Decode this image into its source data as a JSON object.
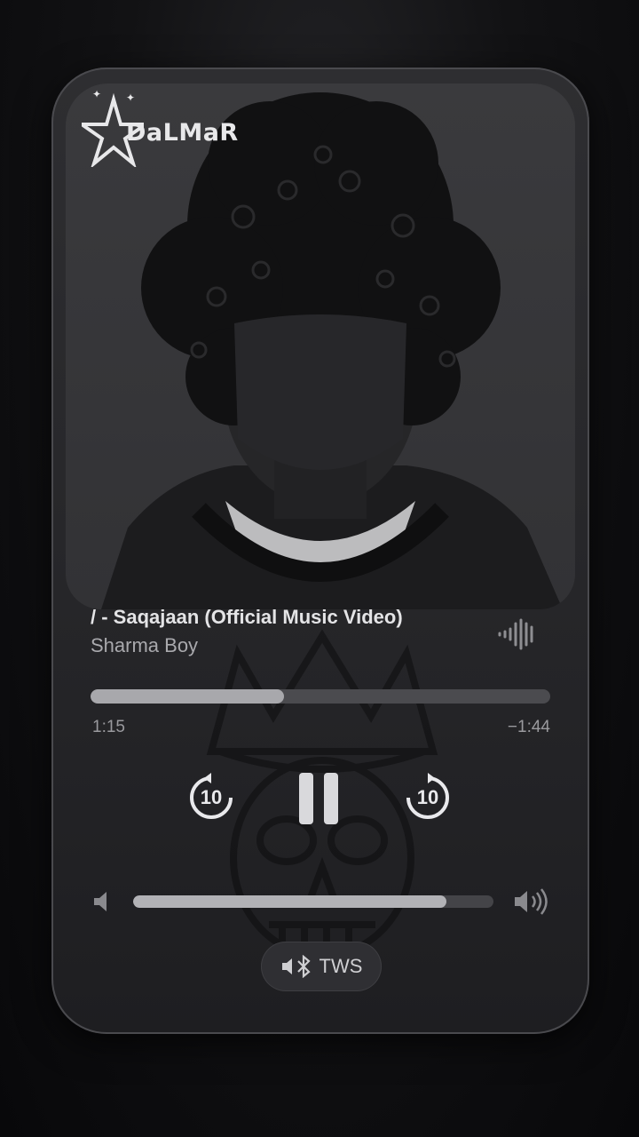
{
  "watermark": {
    "brand": "DaLMaR"
  },
  "track": {
    "title": "/ - Saqajaan (Official Music Video)",
    "artist": "Sharma Boy"
  },
  "playback": {
    "elapsed": "1:15",
    "remaining": "−1:44",
    "progress_fraction": 0.42,
    "state": "playing"
  },
  "controls": {
    "skip_back_seconds": "10",
    "skip_forward_seconds": "10"
  },
  "volume": {
    "level_fraction": 0.87
  },
  "output_device": {
    "label": "TWS"
  },
  "icons": {
    "audio_wave": "waveform-icon",
    "skip_back": "rewind-10-icon",
    "pause": "pause-icon",
    "skip_forward": "forward-10-icon",
    "volume_low": "speaker-low-icon",
    "volume_high": "speaker-high-icon",
    "output": "bluetooth-speaker-icon"
  },
  "colors": {
    "card": "#2a2a2d",
    "text_primary": "#e4e4e6",
    "text_secondary": "#a9a9ad",
    "track": "#4b4b4f",
    "fill": "#a8a8ac"
  }
}
